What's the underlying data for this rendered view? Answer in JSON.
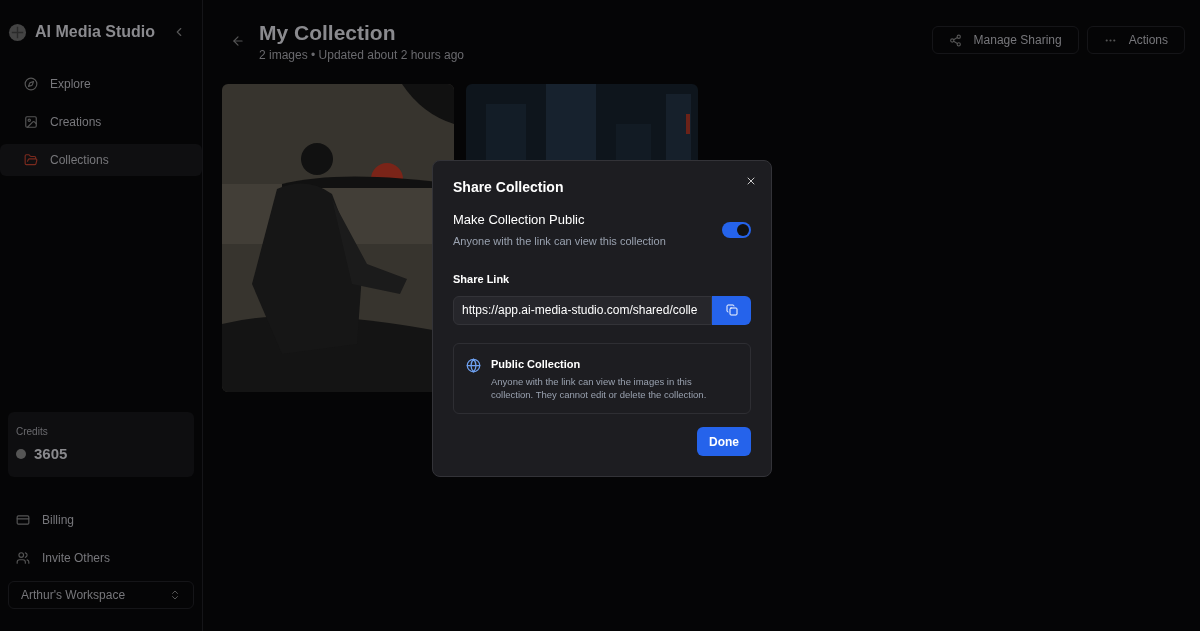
{
  "sidebar": {
    "brand": "AI Media Studio",
    "items": [
      {
        "label": "Explore",
        "selected": false
      },
      {
        "label": "Creations",
        "selected": false
      },
      {
        "label": "Collections",
        "selected": true
      }
    ],
    "credits": {
      "label": "Credits",
      "value": "3605"
    },
    "footer_items": [
      {
        "label": "Billing"
      },
      {
        "label": "Invite Others"
      }
    ],
    "workspace": "Arthur's Workspace"
  },
  "header": {
    "title": "My Collection",
    "subtitle": "2 images • Updated about 2 hours ago",
    "buttons": [
      {
        "label": "Manage Sharing"
      },
      {
        "label": "Actions"
      }
    ]
  },
  "dialog": {
    "title": "Share Collection",
    "public_toggle": {
      "label": "Make Collection Public",
      "description": "Anyone with the link can view this collection",
      "on": true
    },
    "link_label": "Share Link",
    "link_value": "https://app.ai-media-studio.com/shared/colle",
    "info": {
      "title": "Public Collection",
      "text": "Anyone with the link can view the images in this collection. They cannot edit or delete the collection."
    },
    "done": "Done"
  }
}
